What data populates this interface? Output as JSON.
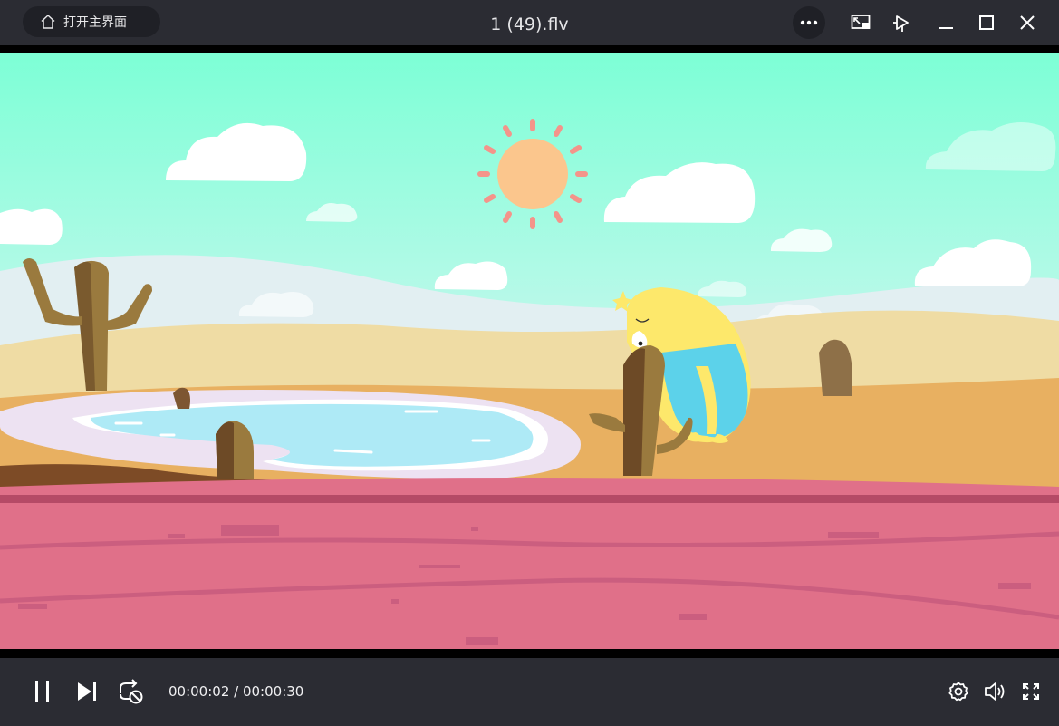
{
  "titlebar": {
    "home_label": "打开主界面",
    "title": "1 (49).flv",
    "icons": [
      "home-icon",
      "more-icon",
      "mini-window-icon",
      "pin-on-top-icon",
      "minimize-icon",
      "maximize-icon",
      "close-icon"
    ]
  },
  "controls": {
    "current_time": "00:00:02",
    "separator": " / ",
    "total_time": "00:00:30",
    "icons": [
      "pause-icon",
      "next-icon",
      "loop-off-icon",
      "settings-icon",
      "volume-icon",
      "fullscreen-icon"
    ]
  },
  "colors": {
    "chrome_bg": "#2b2c33",
    "button_bg": "#1f2026",
    "text": "#e6e6e8"
  }
}
